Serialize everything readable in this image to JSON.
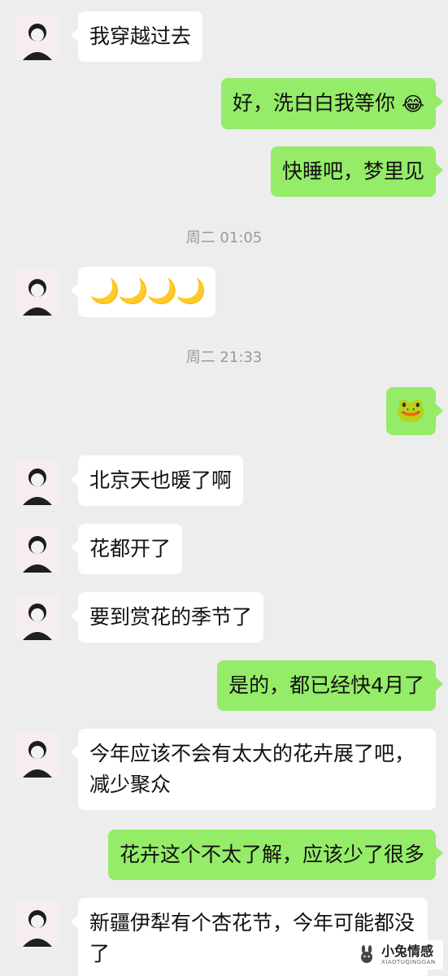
{
  "messages": [
    {
      "side": "in",
      "text": "我穿越过去"
    },
    {
      "side": "out",
      "text": "好，洗白白我等你",
      "emoji": "😂"
    },
    {
      "side": "out",
      "text": "快睡吧，梦里见"
    },
    {
      "time": "周二 01:05"
    },
    {
      "side": "in",
      "text": "🌙🌙🌙🌙"
    },
    {
      "time": "周二 21:33"
    },
    {
      "side": "out",
      "text": "🐸"
    },
    {
      "side": "in",
      "text": "北京天也暖了啊"
    },
    {
      "side": "in",
      "text": "花都开了"
    },
    {
      "side": "in",
      "text": "要到赏花的季节了"
    },
    {
      "side": "out",
      "text": "是的，都已经快4月了"
    },
    {
      "side": "in",
      "text": "今年应该不会有太大的花卉展了吧，减少聚众"
    },
    {
      "side": "out",
      "text": "花卉这个不太了解，应该少了很多"
    },
    {
      "side": "in",
      "text": "新疆伊犁有个杏花节，今年可能都没了"
    }
  ],
  "watermark": {
    "title": "小兔情感",
    "sub": "XIAOTUQINGGAN"
  },
  "colors": {
    "background": "#ededed",
    "incoming": "#ffffff",
    "outgoing": "#95ec69",
    "time": "#9a9a9a"
  }
}
